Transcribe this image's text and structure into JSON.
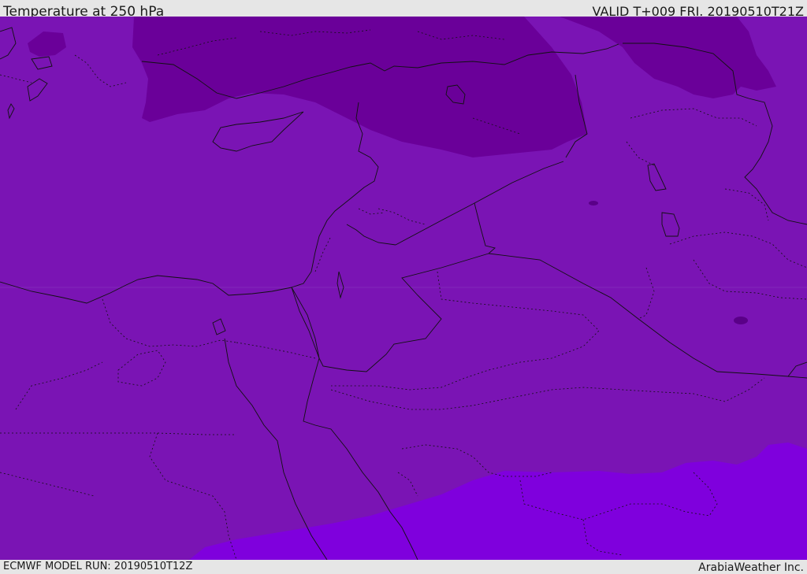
{
  "header": {
    "title": "Temperature at 250 hPa",
    "valid": "VALID T+009 FRI. 20190510T21Z"
  },
  "footer": {
    "model_run": "ECMWF MODEL RUN: 20190510T12Z",
    "credit": "ArabiaWeather Inc."
  },
  "colors": {
    "field_mid": "#7a14b4",
    "field_cold": "#6a0099",
    "field_warm": "#7f00dd",
    "border": "#111111"
  }
}
